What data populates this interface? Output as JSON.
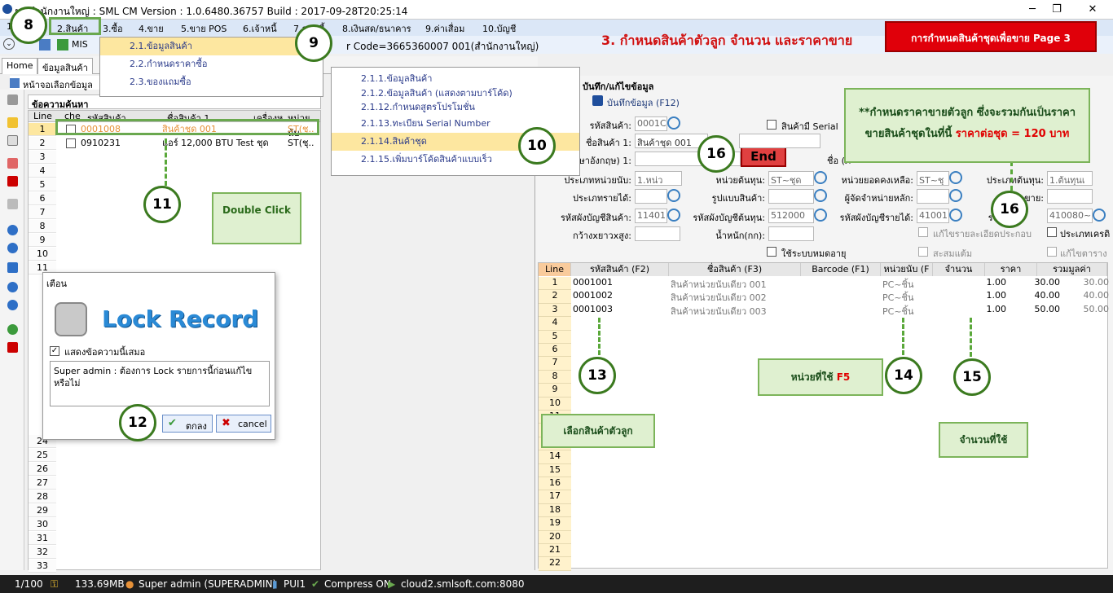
{
  "window": {
    "title": "ยา สำนักงานใหญ่ : SML CM Version : 1.0.6480.36757  Build : 2017-09-28T20:25:14"
  },
  "menu": [
    {
      "label": "1"
    },
    {
      "label": "2.สินค้า"
    },
    {
      "label": "3.ซื้อ"
    },
    {
      "label": "4.ขาย"
    },
    {
      "label": "5.ขาย POS"
    },
    {
      "label": "6.เจ้าหนี้"
    },
    {
      "label": "7.ลูกหนี้"
    },
    {
      "label": "8.เงินสด/ธนาคาร"
    },
    {
      "label": "9.ค่าเสื่อม"
    },
    {
      "label": "10.บัญชี"
    }
  ],
  "toolbar": {
    "mis": "MIS",
    "user_code": "r Code=3665360007 001(สำนักงานใหญ่)"
  },
  "heading": {
    "title": "3. กำหนดสินค้าตัวลูก จำนวน และราคาขาย",
    "banner": "การกำหนดสินค้าชุดเพื่อขาย Page 3"
  },
  "tabs": [
    {
      "label": "Home"
    },
    {
      "label": "ข้อมูลสินค้า"
    }
  ],
  "left_panel": {
    "header": "หน้าจอเลือกข้อมูล",
    "search_title": "ข้อความค้นหา",
    "columns": [
      "Line",
      "che",
      "รหัสสินค้า",
      "ชื่อสินค้า 1",
      "เครื่องห",
      "หน่วยนับ"
    ],
    "rows": [
      {
        "line": "1",
        "code": "0001008",
        "name": "สินค้าชุด 001",
        "unit": "ST(ชุ.."
      },
      {
        "line": "2",
        "code": "0910231",
        "name": "แอร์ 12,000 BTU Test ชุด",
        "unit": "ST(ชุ.."
      }
    ],
    "line_numbers": [
      "3",
      "4",
      "5",
      "6",
      "7",
      "8",
      "9",
      "10",
      "11",
      "24",
      "25",
      "26",
      "27",
      "28",
      "29",
      "30",
      "31",
      "32",
      "33"
    ]
  },
  "menu_dropdown": {
    "items": [
      {
        "label": "2.1.ข้อมูลสินค้า"
      },
      {
        "label": "2.2.กำหนดราคาซื้อ"
      },
      {
        "label": "2.3.ของแถมซื้อ"
      }
    ]
  },
  "submenu": {
    "items": [
      {
        "label": "2.1.1.ข้อมูลสินค้า"
      },
      {
        "label": "2.1.2.ข้อมูลสินค้า (แสดงตามบาร์โค้ด)"
      },
      {
        "label": "2.1.12.กำหนดสูตรโปรโมชั่น"
      },
      {
        "label": "2.1.13.ทะเบียน Serial Number"
      },
      {
        "label": "2.1.14.สินค้าชุด"
      },
      {
        "label": "2.1.15.เพิ่มบาร์โค้ดสินค้าแบบเร็ว"
      }
    ]
  },
  "dialog": {
    "title": "เตือน",
    "header": "Lock Record",
    "checkbox_label": "แสดงข้อความนี้เสมอ",
    "message": "Super admin : ต้องการ Lock รายการนี้ก่อนแก้ไขหรือไม่",
    "ok": "ตกลง",
    "cancel": "cancel"
  },
  "right_panel": {
    "title": "บันทึก/แก้ไขข้อมูล",
    "save_button": "บันทึกข้อมูล (F12)",
    "end_button": "End",
    "serial_label": "สินค้ามี Serial",
    "fields": {
      "code_label": "รหัสสินค้า:",
      "code_value": "0001C",
      "name1_label": "ชื่อสินค้า 1:",
      "name1_value": "สินค้าชุด 001",
      "name_en_label": "ภาษาอังกฤษ) 1:",
      "name_other_label": "ชื่อ (ภ",
      "unit_type_label": "ประเภทหน่วยนับ:",
      "unit_type_value": "1.หน่ว",
      "cost_unit_label": "หน่วยต้นทุน:",
      "cost_unit_value": "ST~ชุด",
      "stock_unit_label": "หน่วยยอดคงเหลือ:",
      "stock_unit_value": "ST~ชุ",
      "cost_type_label": "ประเภทต้นทุน:",
      "cost_type_value": "1.ต้นทุนเ",
      "income_type_label": "ประเภทรายได้:",
      "image_label": "รูปแบบสินค้า:",
      "distributor_label": "ผู้จัดจำหน่ายหลัก:",
      "sale_label": "ขาย:",
      "acc_product_label": "รหัสผังบัญชีสินค้า:",
      "acc_product_value": "11401",
      "acc_cost_label": "รหัสผังบัญชีต้นทุน:",
      "acc_cost_value": "512000",
      "acc_income_label": "รหัสผังบัญชีรายได้:",
      "acc_income_value": "41001",
      "acc_return_label": "รหัสผ",
      "acc_return_value": "410080~",
      "dimension_label": "กว้างxยาวxสูง:",
      "weight_label": "น้ำหนัก(กก):",
      "expire_label": "ใช้ระบบหมดอายุ",
      "edit_detail_label": "แก้ไขรายละเอียดประกอบ",
      "credit_type_label": "ประเภทเครดิ",
      "accumulate_label": "สะสมแต้ม",
      "edit_table_label": "แก้ไขตาราง"
    },
    "grid_columns": [
      "Line",
      "รหัสสินค้า (F2)",
      "ชื่อสินค้า (F3)",
      "Barcode (F1)",
      "หน่วยนับ (F",
      "จำนวน",
      "ราคา",
      "รวมมูลค่า"
    ],
    "grid_rows": [
      {
        "line": "1",
        "code": "0001001",
        "name": "สินค้าหน่วยนับเดียว 001",
        "unit": "PC~ชิ้น",
        "qty": "1.00",
        "price": "30.00",
        "total": "30.00"
      },
      {
        "line": "2",
        "code": "0001002",
        "name": "สินค้าหน่วยนับเดียว 002",
        "unit": "PC~ชิ้น",
        "qty": "1.00",
        "price": "40.00",
        "total": "40.00"
      },
      {
        "line": "3",
        "code": "0001003",
        "name": "สินค้าหน่วยนับเดียว 003",
        "unit": "PC~ชิ้น",
        "qty": "1.00",
        "price": "50.00",
        "total": "50.00"
      }
    ],
    "grid_line_numbers": [
      "4",
      "5",
      "6",
      "7",
      "8",
      "9",
      "10",
      "11",
      "12",
      "13",
      "14",
      "15",
      "16",
      "17",
      "18",
      "19",
      "20",
      "21",
      "22"
    ]
  },
  "annotations": {
    "circles": [
      "8",
      "9",
      "10",
      "11",
      "12",
      "13",
      "14",
      "15",
      "16",
      "16"
    ],
    "double_click": "Double Click",
    "price_note_line1": "**กำหนดราคาขายตัวลูก ซึ่งจะรวมกันเป็นราคา",
    "price_note_line2": "ขายสินค้าชุดในที่นี้",
    "price_note_highlight": "ราคาต่อชุด = 120 บาท",
    "select_child": "เลือกสินค้าตัวลูก",
    "unit_used": "หน่วยที่ใช้",
    "unit_key": "F5",
    "qty_used": "จำนวนที่ใช้"
  },
  "statusbar": {
    "page": "1/100",
    "memory": "133.69MB",
    "user": "Super admin (SUPERADMIN)",
    "pui": "PUI1",
    "compress": "Compress ON",
    "server": "cloud2.smlsoft.com:8080"
  }
}
